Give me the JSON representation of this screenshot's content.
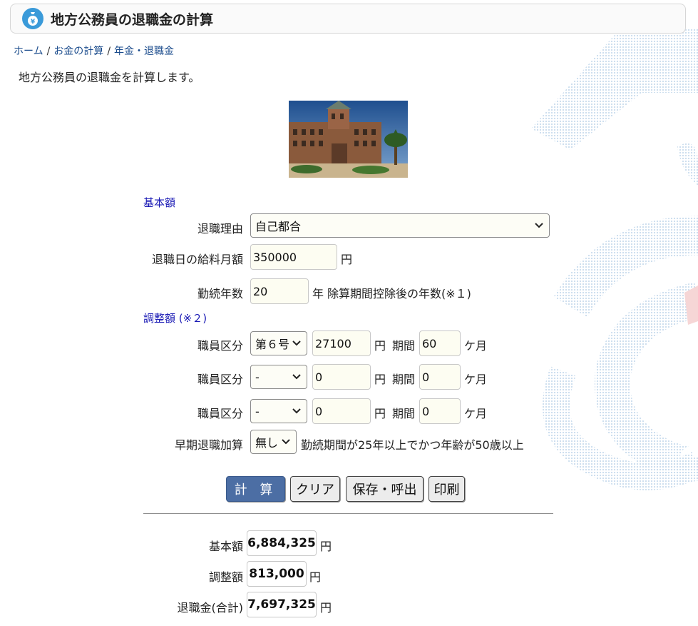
{
  "header": {
    "title": "地方公務員の退職金の計算",
    "logo_icon": "money-bag-icon"
  },
  "breadcrumb": {
    "items": [
      "ホーム",
      "お金の計算",
      "年金・退職金"
    ],
    "separator": "/"
  },
  "intro": "地方公務員の退職金を計算します。",
  "basic": {
    "section_label": "基本額",
    "reason_label": "退職理由",
    "reason_value": "自己都合",
    "salary_label": "退職日の給料月額",
    "salary_value": "350000",
    "salary_unit": "円",
    "years_label": "勤続年数",
    "years_value": "20",
    "years_unit": "年",
    "years_note": "除算期間控除後の年数(※１)"
  },
  "adjust": {
    "section_label": "調整額 (※２)",
    "rows": [
      {
        "label": "職員区分",
        "category": "第６号",
        "amount": "27100",
        "unit": "円",
        "period_label": "期間",
        "period": "60",
        "period_unit": "ケ月"
      },
      {
        "label": "職員区分",
        "category": "-",
        "amount": "0",
        "unit": "円",
        "period_label": "期間",
        "period": "0",
        "period_unit": "ケ月"
      },
      {
        "label": "職員区分",
        "category": "-",
        "amount": "0",
        "unit": "円",
        "period_label": "期間",
        "period": "0",
        "period_unit": "ケ月"
      }
    ],
    "early_label": "早期退職加算",
    "early_value": "無し",
    "early_note": "勤続期間が25年以上でかつ年齢が50歳以上"
  },
  "buttons": {
    "calc": "計 算",
    "clear": "クリア",
    "save": "保存・呼出",
    "print": "印刷"
  },
  "results": {
    "basic_label": "基本額",
    "basic_value": "6,884,325",
    "adjust_label": "調整額",
    "adjust_value": "813,000",
    "total_label": "退職金(合計)",
    "total_value": "7,697,325",
    "unit": "円"
  },
  "colors": {
    "accent": "#4c6ea4",
    "section_label": "#1a1ab5",
    "link": "#1a4b8c",
    "logo": "#3a9ad9"
  }
}
